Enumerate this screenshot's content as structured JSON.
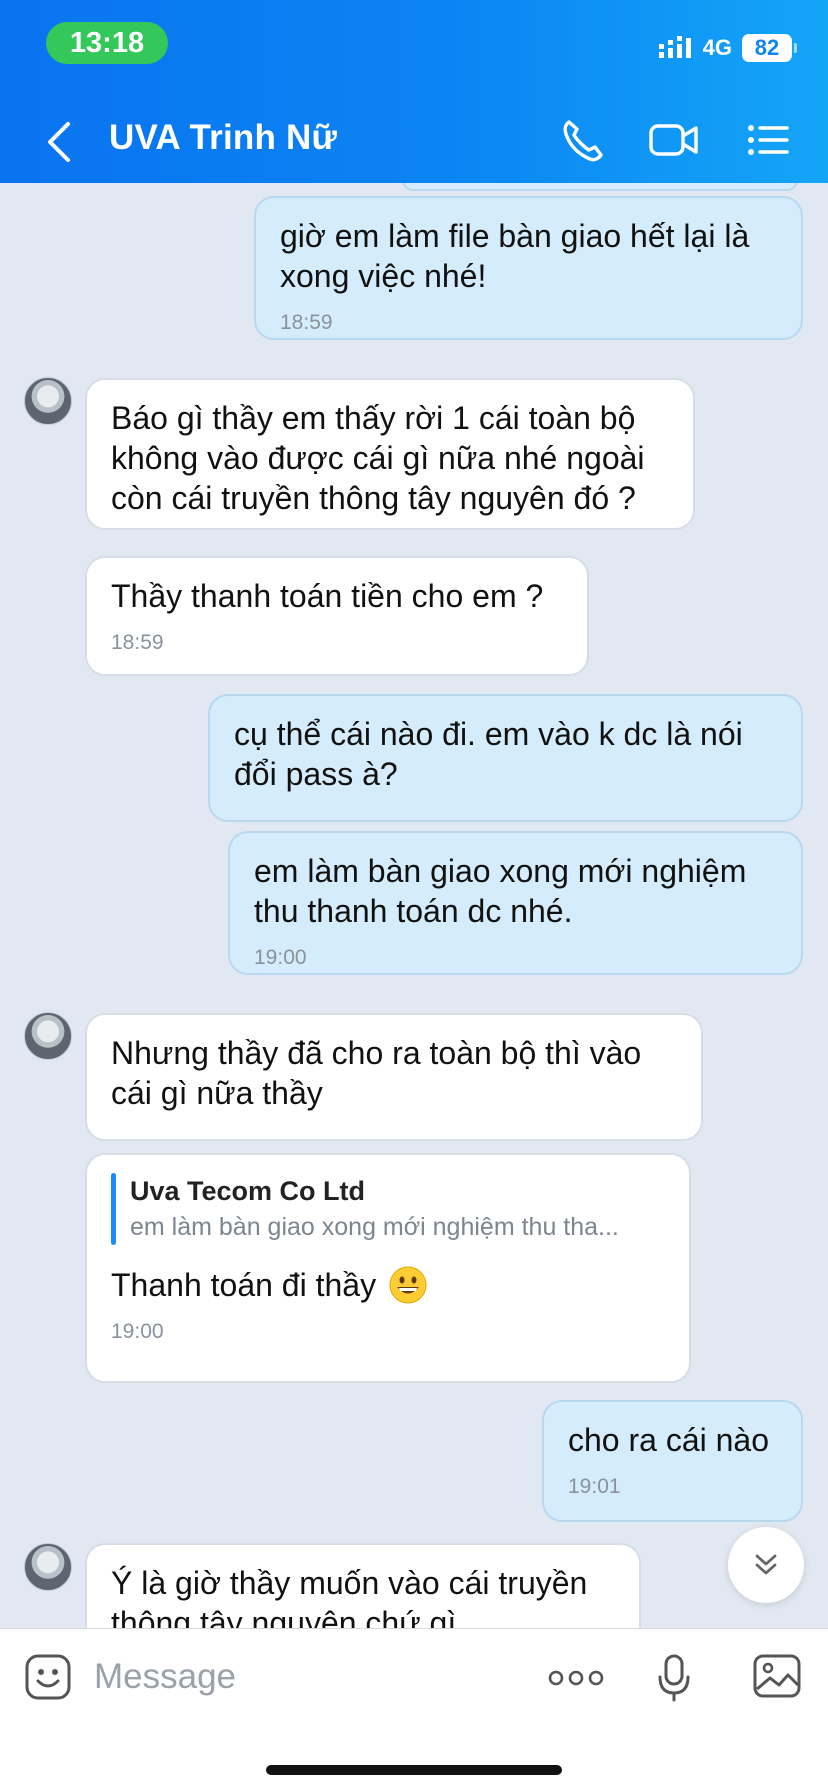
{
  "status_bar": {
    "time": "13:18",
    "network": "4G",
    "battery": "82"
  },
  "header": {
    "contact_name": "UVA Trinh Nữ"
  },
  "messages": {
    "m1": {
      "text": "giờ em làm file bàn giao hết lại là xong việc nhé!",
      "time": "18:59",
      "direction": "out"
    },
    "m2": {
      "text": "Báo gì thầy em thấy rời 1 cái toàn bộ không vào được cái gì nữa nhé ngoài còn cái truyền thông tây nguyên đó ?",
      "direction": "in"
    },
    "m3": {
      "text": "Thầy thanh toán tiền cho em ?",
      "time": "18:59",
      "direction": "in"
    },
    "m4": {
      "text": "cụ thể cái nào đi. em vào k dc là nói đổi pass à?",
      "direction": "out"
    },
    "m5": {
      "text": "em làm bàn giao xong mới nghiệm thu thanh toán dc nhé.",
      "time": "19:00",
      "direction": "out"
    },
    "m6": {
      "text": "Nhưng thầy đã cho ra toàn bộ thì vào cái gì nữa thầy",
      "direction": "in"
    },
    "m7": {
      "quote_author": "Uva Tecom Co Ltd",
      "quote_text": "em làm bàn giao xong mới nghiệm thu tha...",
      "text": "Thanh toán đi thầy",
      "emoji": "grinning-face",
      "time": "19:00",
      "direction": "in"
    },
    "m8": {
      "text": "cho ra cái nào",
      "time": "19:01",
      "direction": "out"
    },
    "m9": {
      "text": "Ý là giờ thầy muốn vào cái truyền thông tây nguyên chứ gì",
      "direction": "in"
    }
  },
  "input": {
    "placeholder": "Message"
  },
  "icons": {
    "back": "chevron-left-icon",
    "call": "phone-icon",
    "video": "video-camera-icon",
    "menu": "list-menu-icon",
    "sticker": "sticker-smile-icon",
    "more": "more-dots-icon",
    "mic": "microphone-icon",
    "photo": "image-icon",
    "scroll": "double-chevron-down-icon"
  },
  "colors": {
    "header_start": "#0a73f0",
    "header_end": "#14a5f7",
    "time_pill": "#34c759",
    "outgoing_bubble": "#d4ecfb",
    "incoming_bubble": "#ffffff",
    "background": "#e2e8f1"
  }
}
